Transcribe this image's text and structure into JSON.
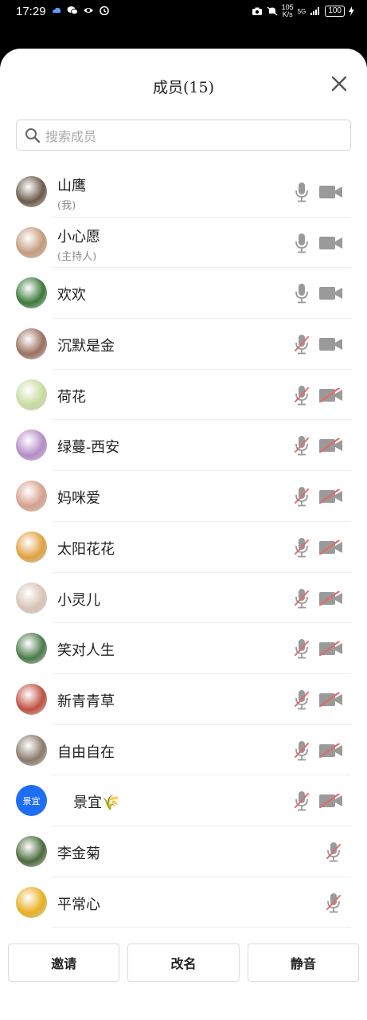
{
  "status_bar": {
    "time": "17:29",
    "speed_top": "105",
    "speed_unit": "K/s",
    "signal": "5G",
    "battery": "100"
  },
  "header": {
    "title": "成员(15)"
  },
  "search": {
    "placeholder": "搜索成员"
  },
  "members": [
    {
      "name": "山鹰",
      "sub": "(我)",
      "avatar_color": "#6b5a4a",
      "mic": "on",
      "cam": "on"
    },
    {
      "name": "小心愿",
      "sub": "(主持人)",
      "avatar_color": "#c49a7c",
      "mic": "on",
      "cam": "on"
    },
    {
      "name": "欢欢",
      "avatar_color": "#3a7a3a",
      "mic": "on",
      "cam": "on"
    },
    {
      "name": "沉默是金",
      "avatar_color": "#9a7060",
      "mic": "muted",
      "cam": "on"
    },
    {
      "name": "荷花",
      "avatar_color": "#c8dca0",
      "mic": "muted",
      "cam": "off"
    },
    {
      "name": "绿蔓-西安",
      "avatar_color": "#b48cc8",
      "mic": "muted",
      "cam": "off"
    },
    {
      "name": "妈咪爱",
      "avatar_color": "#d6a08c",
      "mic": "muted",
      "cam": "off"
    },
    {
      "name": "太阳花花",
      "avatar_color": "#e0a040",
      "mic": "muted",
      "cam": "off"
    },
    {
      "name": "小灵儿",
      "avatar_color": "#d8c4b4",
      "mic": "muted",
      "cam": "off"
    },
    {
      "name": "笑对人生",
      "avatar_color": "#4a7a4a",
      "mic": "muted",
      "cam": "off"
    },
    {
      "name": "新青青草",
      "avatar_color": "#c05040",
      "mic": "muted",
      "cam": "off"
    },
    {
      "name": "自由自在",
      "avatar_color": "#8a7a6a",
      "mic": "muted",
      "cam": "off"
    },
    {
      "name": "景宜🌾",
      "avatar_text": "景宜",
      "avatar_color": "#1e6ef5",
      "mic": "muted",
      "cam": "off"
    },
    {
      "name": "李金菊",
      "avatar_color": "#4a6a3a",
      "mic": "muted",
      "cam": "none"
    },
    {
      "name": "平常心",
      "avatar_color": "#e8b020",
      "mic": "muted",
      "cam": "none"
    }
  ],
  "footer": {
    "invite": "邀请",
    "rename": "改名",
    "mute": "静音"
  },
  "colors": {
    "icon_gray": "#9a9a9a",
    "muted_red": "#e06a6a",
    "accent_blue": "#1e6ef5"
  }
}
